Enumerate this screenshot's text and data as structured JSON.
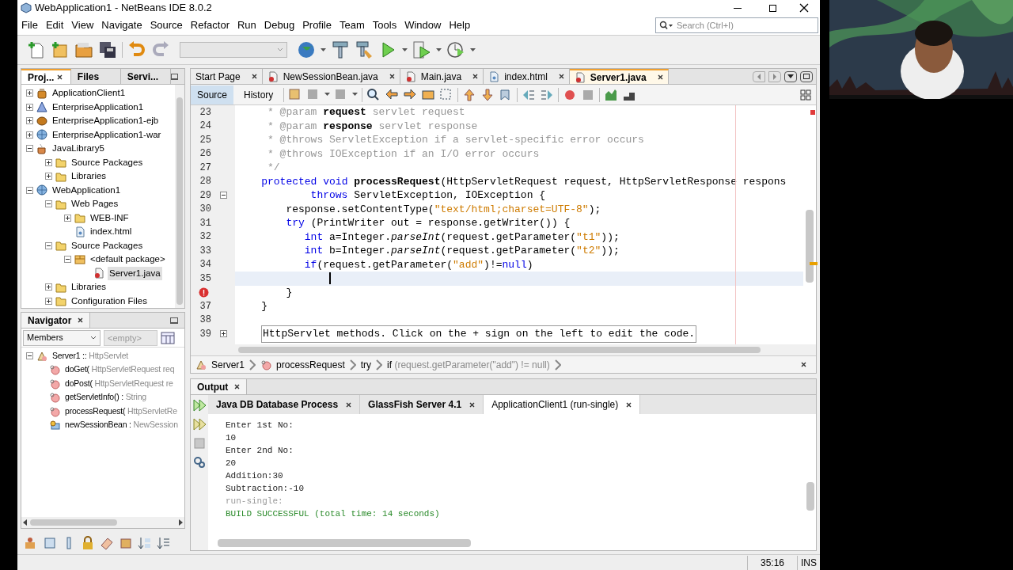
{
  "window": {
    "title": "WebApplication1 - NetBeans IDE 8.0.2"
  },
  "menu": [
    "File",
    "Edit",
    "View",
    "Navigate",
    "Source",
    "Refactor",
    "Run",
    "Debug",
    "Profile",
    "Team",
    "Tools",
    "Window",
    "Help"
  ],
  "search": {
    "placeholder": "Search (Ctrl+I)"
  },
  "left_tabs": [
    {
      "label": "Proj...",
      "selected": true,
      "closable": true
    },
    {
      "label": "Files",
      "selected": false,
      "closable": false
    },
    {
      "label": "Servi...",
      "selected": false,
      "closable": false
    }
  ],
  "projects": [
    {
      "label": "ApplicationClient1",
      "kind": "client",
      "expanded": false,
      "selected": false
    },
    {
      "label": "EnterpriseApplication1",
      "kind": "enterprise",
      "expanded": false,
      "selected": false
    },
    {
      "label": "EnterpriseApplication1-ejb",
      "kind": "ejb",
      "expanded": false,
      "selected": false
    },
    {
      "label": "EnterpriseApplication1-war",
      "kind": "web",
      "expanded": false,
      "selected": false
    },
    {
      "label": "JavaLibrary5",
      "kind": "library",
      "expanded": true,
      "selected": false,
      "children": [
        {
          "label": "Source Packages",
          "kind": "folder",
          "expanded": false,
          "selected": false
        },
        {
          "label": "Libraries",
          "kind": "folder",
          "expanded": false,
          "selected": false
        }
      ]
    },
    {
      "label": "WebApplication1",
      "kind": "web",
      "expanded": true,
      "selected": false,
      "children": [
        {
          "label": "Web Pages",
          "kind": "folder",
          "expanded": true,
          "selected": false,
          "children": [
            {
              "label": "WEB-INF",
              "kind": "folder",
              "expanded": false,
              "selected": false
            },
            {
              "label": "index.html",
              "kind": "file",
              "selected": false
            }
          ]
        },
        {
          "label": "Source Packages",
          "kind": "folder",
          "expanded": true,
          "selected": false,
          "children": [
            {
              "label": "<default package>",
              "kind": "package",
              "expanded": true,
              "selected": false,
              "children": [
                {
                  "label": "Server1.java",
                  "kind": "java",
                  "selected": true
                }
              ]
            }
          ]
        },
        {
          "label": "Libraries",
          "kind": "folder",
          "expanded": false,
          "selected": false
        },
        {
          "label": "Configuration Files",
          "kind": "folder",
          "expanded": false,
          "selected": false
        }
      ]
    }
  ],
  "navigator": {
    "title": "Navigator",
    "filter": "Members",
    "filter_placeholder": "<empty>",
    "items": [
      {
        "label": "Server1 ::",
        "detail": "HttpServlet",
        "kind": "class",
        "expanded": true,
        "children": [
          {
            "label": "doGet(",
            "detail": "HttpServletRequest req",
            "kind": "method"
          },
          {
            "label": "doPost(",
            "detail": "HttpServletRequest re",
            "kind": "method"
          },
          {
            "label": "getServletInfo() :",
            "detail": "String",
            "kind": "method"
          },
          {
            "label": "processRequest(",
            "detail": "HttpServletRe",
            "kind": "method"
          },
          {
            "label": "newSessionBean :",
            "detail": "NewSession",
            "kind": "field"
          }
        ]
      }
    ]
  },
  "editor_tabs": [
    {
      "label": "Start Page",
      "kind": "page",
      "selected": false
    },
    {
      "label": "NewSessionBean.java",
      "kind": "java",
      "selected": false
    },
    {
      "label": "Main.java",
      "kind": "java",
      "selected": false
    },
    {
      "label": "index.html",
      "kind": "html",
      "selected": false
    },
    {
      "label": "Server1.java",
      "kind": "java",
      "selected": true
    }
  ],
  "editor_views": [
    {
      "label": "Source",
      "selected": true
    },
    {
      "label": "History",
      "selected": false
    }
  ],
  "code_lines": [
    {
      "number": "23",
      "current": false,
      "error": false,
      "tokens": [
        {
          "kind": "comment",
          "text": "     * @param "
        },
        {
          "kind": "tag",
          "text": "request"
        },
        {
          "kind": "comment",
          "text": " servlet request"
        }
      ]
    },
    {
      "number": "24",
      "current": false,
      "error": false,
      "tokens": [
        {
          "kind": "comment",
          "text": "     * @param "
        },
        {
          "kind": "tag",
          "text": "response"
        },
        {
          "kind": "comment",
          "text": " servlet response"
        }
      ]
    },
    {
      "number": "25",
      "current": false,
      "error": false,
      "tokens": [
        {
          "kind": "comment",
          "text": "     * @throws ServletException if a servlet-specific error occurs"
        }
      ]
    },
    {
      "number": "26",
      "current": false,
      "error": false,
      "tokens": [
        {
          "kind": "comment",
          "text": "     * @throws IOException if an I/O error occurs"
        }
      ]
    },
    {
      "number": "27",
      "current": false,
      "error": false,
      "tokens": [
        {
          "kind": "comment",
          "text": "     */"
        }
      ]
    },
    {
      "number": "28",
      "current": false,
      "error": false,
      "tokens": [
        {
          "kind": "keyword",
          "text": "    protected"
        },
        {
          "kind": "keyword",
          "text": " void"
        },
        {
          "kind": "bold",
          "text": " processRequest"
        },
        {
          "kind": "plain",
          "text": "(HttpServletRequest request, HttpServletResponse respons"
        }
      ]
    },
    {
      "number": "29",
      "current": false,
      "error": false,
      "folded": false,
      "tokens": [
        {
          "kind": "keyword",
          "text": "            throws"
        },
        {
          "kind": "plain",
          "text": " ServletException, IOException {"
        }
      ]
    },
    {
      "number": "30",
      "current": false,
      "error": false,
      "tokens": [
        {
          "kind": "plain",
          "text": "        response.setContentType("
        },
        {
          "kind": "string",
          "text": "\"text/html;charset=UTF-8\""
        },
        {
          "kind": "plain",
          "text": ");"
        }
      ]
    },
    {
      "number": "31",
      "current": false,
      "error": false,
      "tokens": [
        {
          "kind": "keyword",
          "text": "        try"
        },
        {
          "kind": "plain",
          "text": " (PrintWriter out = response.getWriter()) {"
        }
      ]
    },
    {
      "number": "32",
      "current": false,
      "error": false,
      "tokens": [
        {
          "kind": "keyword",
          "text": "           int"
        },
        {
          "kind": "plain",
          "text": " a=Integer."
        },
        {
          "kind": "italic",
          "text": "parseInt"
        },
        {
          "kind": "plain",
          "text": "(request.getParameter("
        },
        {
          "kind": "string",
          "text": "\"t1\""
        },
        {
          "kind": "plain",
          "text": "));"
        }
      ]
    },
    {
      "number": "33",
      "current": false,
      "error": false,
      "tokens": [
        {
          "kind": "keyword",
          "text": "           int"
        },
        {
          "kind": "plain",
          "text": " b=Integer."
        },
        {
          "kind": "italic",
          "text": "parseInt"
        },
        {
          "kind": "plain",
          "text": "(request.getParameter("
        },
        {
          "kind": "string",
          "text": "\"t2\""
        },
        {
          "kind": "plain",
          "text": "));"
        }
      ]
    },
    {
      "number": "34",
      "current": false,
      "error": false,
      "tokens": [
        {
          "kind": "keyword",
          "text": "           if"
        },
        {
          "kind": "plain",
          "text": "(request.getParameter("
        },
        {
          "kind": "string",
          "text": "\"add\""
        },
        {
          "kind": "plain",
          "text": ")!="
        },
        {
          "kind": "keyword",
          "text": "null"
        },
        {
          "kind": "plain",
          "text": ")"
        }
      ]
    },
    {
      "number": "35",
      "current": true,
      "error": false,
      "cursor": true
    },
    {
      "current": false,
      "error": true,
      "tokens": [
        {
          "kind": "plain",
          "text": "        }"
        }
      ]
    },
    {
      "number": "37",
      "current": false,
      "error": false,
      "tokens": [
        {
          "kind": "plain",
          "text": "    }"
        }
      ]
    },
    {
      "number": "38",
      "current": false,
      "error": false
    },
    {
      "number": "39",
      "current": false,
      "error": false,
      "folded": true,
      "tokens": [
        {
          "kind": "fold",
          "text": "HttpServlet methods. Click on the + sign on the left to edit the code."
        }
      ]
    }
  ],
  "breadcrumb": [
    {
      "label": "Server1",
      "kind": "class"
    },
    {
      "label": "processRequest",
      "kind": "method"
    },
    {
      "label": "try"
    },
    {
      "label": "if",
      "detail": "(request.getParameter(\"add\") != null)"
    }
  ],
  "output": {
    "title": "Output",
    "tabs": [
      {
        "label": "Java DB Database Process",
        "selected": false
      },
      {
        "label": "GlassFish Server 4.1",
        "selected": false
      },
      {
        "label": "ApplicationClient1 (run-single)",
        "selected": true
      }
    ],
    "lines": [
      {
        "kind": "normal",
        "text": "Enter 1st No:"
      },
      {
        "kind": "normal",
        "text": "10"
      },
      {
        "kind": "normal",
        "text": "Enter 2nd No:"
      },
      {
        "kind": "normal",
        "text": "20"
      },
      {
        "kind": "normal",
        "text": "Addition:30"
      },
      {
        "kind": "normal",
        "text": "Subtraction:-10"
      },
      {
        "kind": "muted",
        "text": "run-single:"
      },
      {
        "kind": "success",
        "text": "BUILD SUCCESSFUL (total time: 14 seconds)"
      }
    ]
  },
  "status_bar": {
    "position": "35:16",
    "mode": "INS"
  }
}
